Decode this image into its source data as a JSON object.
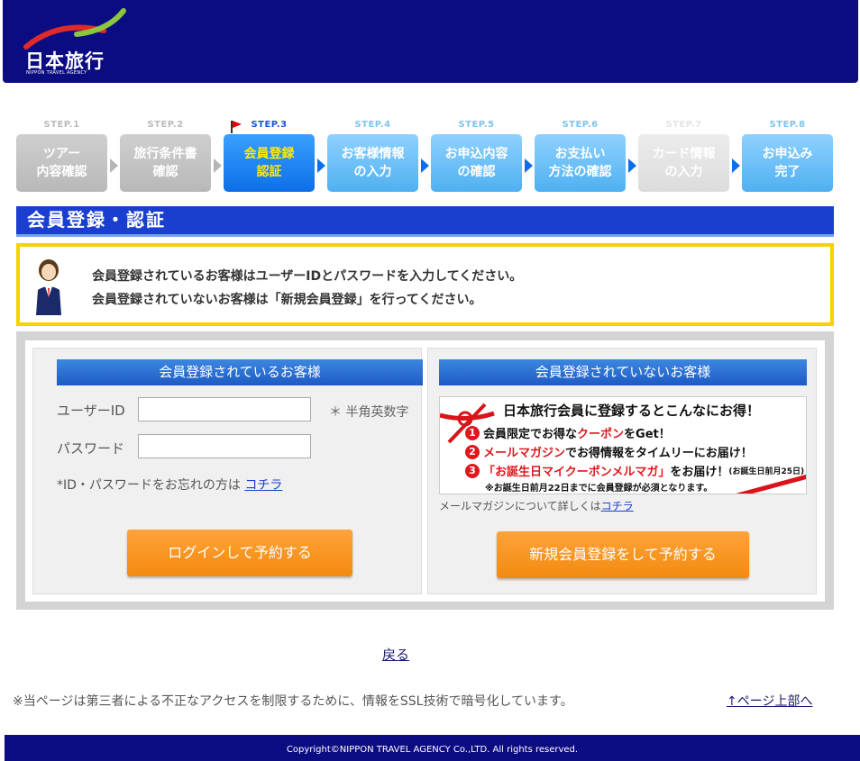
{
  "header": {
    "logo_text": "日本旅行",
    "logo_sub": "NIPPON TRAVEL AGENCY"
  },
  "steps": [
    {
      "num": "STEP.1",
      "label_1": "ツアー",
      "label_2": "内容確認",
      "state": "done"
    },
    {
      "num": "STEP.2",
      "label_1": "旅行条件書",
      "label_2": "確認",
      "state": "done"
    },
    {
      "num": "STEP.3",
      "label_1": "会員登録",
      "label_2": "認証",
      "state": "current"
    },
    {
      "num": "STEP.4",
      "label_1": "お客様情報",
      "label_2": "の入力",
      "state": "future"
    },
    {
      "num": "STEP.5",
      "label_1": "お申込内容",
      "label_2": "の確認",
      "state": "future"
    },
    {
      "num": "STEP.6",
      "label_1": "お支払い",
      "label_2": "方法の確認",
      "state": "future"
    },
    {
      "num": "STEP.7",
      "label_1": "カード情報",
      "label_2": "の入力",
      "state": "disabled"
    },
    {
      "num": "STEP.8",
      "label_1": "お申込み",
      "label_2": "完了",
      "state": "future"
    }
  ],
  "section_title": "会員登録・認証",
  "notice": {
    "line_1": "会員登録されているお客様はユーザーIDとパスワードを入力してください。",
    "line_2": "会員登録されていないお客様は「新規会員登録」を行ってください。"
  },
  "member_panel": {
    "heading": "会員登録されているお客様",
    "user_id_label": "ユーザーID",
    "user_id_value": "",
    "password_label": "パスワード",
    "password_value": "",
    "user_id_note": "＊ 半角英数字",
    "forgot_text": "*ID・パスワードをお忘れの方は",
    "forgot_link": "コチラ",
    "login_button": "ログインして予約する"
  },
  "guest_panel": {
    "heading": "会員登録されていないお客様",
    "banner_title": "日本旅行会員に登録するとこんなにお得！",
    "benefit_1_num": "1",
    "benefit_1_pre": "会員限定でお得な",
    "benefit_1_hl": "クーポン",
    "benefit_1_post": "をGet！",
    "benefit_2_num": "2",
    "benefit_2_hl": "メールマガジン",
    "benefit_2_post": "でお得情報をタイムリーにお届け！",
    "benefit_3_num": "3",
    "benefit_3_hl": "「お誕生日マイクーポンメルマガ」",
    "benefit_3_post": "をお届け！",
    "benefit_3_small": "(お誕生日前月25日)",
    "banner_foot": "※お誕生日前月22日までに会員登録が必須となります。",
    "mail_info_text": "メールマガジンについて詳しくは",
    "mail_info_link": "コチラ",
    "register_button": "新規会員登録をして予約する"
  },
  "back_link": "戻る",
  "ssl_note": "※当ページは第三者による不正なアクセスを制限するために、情報をSSL技術で暗号化しています。",
  "top_link": "↑ページ上部へ",
  "footer": "Copyright©NIPPON TRAVEL AGENCY Co.,LTD. All rights reserved.",
  "colors": {
    "brand_navy": "#0c0c82",
    "section_blue": "#1a3fd0",
    "notice_yellow": "#f5d300",
    "button_orange": "#f28a0f"
  }
}
